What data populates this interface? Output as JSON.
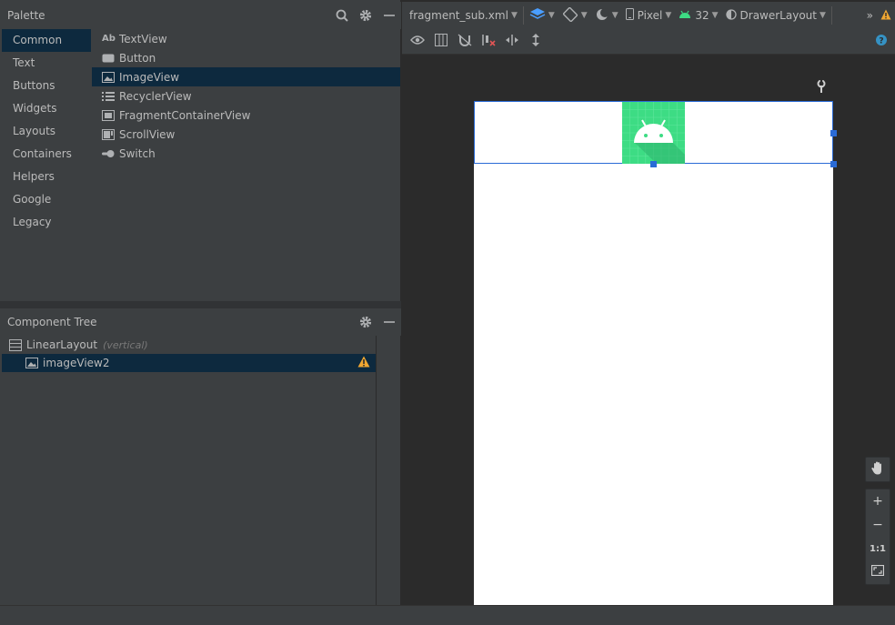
{
  "palette": {
    "title": "Palette",
    "categories": [
      "Common",
      "Text",
      "Buttons",
      "Widgets",
      "Layouts",
      "Containers",
      "Helpers",
      "Google",
      "Legacy"
    ],
    "selected_category": "Common",
    "widgets": [
      {
        "label": "TextView",
        "icon": "textview-icon"
      },
      {
        "label": "Button",
        "icon": "button-icon"
      },
      {
        "label": "ImageView",
        "icon": "imageview-icon"
      },
      {
        "label": "RecyclerView",
        "icon": "recyclerview-icon"
      },
      {
        "label": "FragmentContainerView",
        "icon": "fragment-icon"
      },
      {
        "label": "ScrollView",
        "icon": "scrollview-icon"
      },
      {
        "label": "Switch",
        "icon": "switch-icon"
      }
    ],
    "selected_widget": "ImageView",
    "textview_icon_text": "Ab"
  },
  "component_tree": {
    "title": "Component Tree",
    "root": {
      "label": "LinearLayout",
      "hint": "(vertical)"
    },
    "child": {
      "label": "imageView2",
      "has_warning": true
    }
  },
  "toolbar": {
    "file": "fragment_sub.xml",
    "device": "Pixel",
    "api_level": "32",
    "theme": "DrawerLayout",
    "overflow": "»"
  },
  "zoom": {
    "plus": "+",
    "minus": "−",
    "one_to_one": "1:1"
  },
  "colors": {
    "selection": "#0d293e",
    "accent_blue": "#2a6bd6",
    "android_green": "#3ddc84",
    "warning": "#f0a732"
  }
}
